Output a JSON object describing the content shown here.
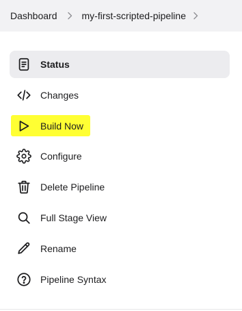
{
  "breadcrumb": {
    "items": [
      "Dashboard",
      "my-first-scripted-pipeline"
    ]
  },
  "menu": {
    "items": [
      {
        "label": "Status",
        "icon": "document-icon"
      },
      {
        "label": "Changes",
        "icon": "code-icon"
      },
      {
        "label": "Build Now",
        "icon": "play-icon"
      },
      {
        "label": "Configure",
        "icon": "gear-icon"
      },
      {
        "label": "Delete Pipeline",
        "icon": "trash-icon"
      },
      {
        "label": "Full Stage View",
        "icon": "search-icon"
      },
      {
        "label": "Rename",
        "icon": "pencil-icon"
      },
      {
        "label": "Pipeline Syntax",
        "icon": "help-circle-icon"
      }
    ]
  },
  "colors": {
    "highlight": "#ffff33",
    "breadcrumb_bg": "#f2f2f4",
    "active_bg": "#ececef"
  }
}
